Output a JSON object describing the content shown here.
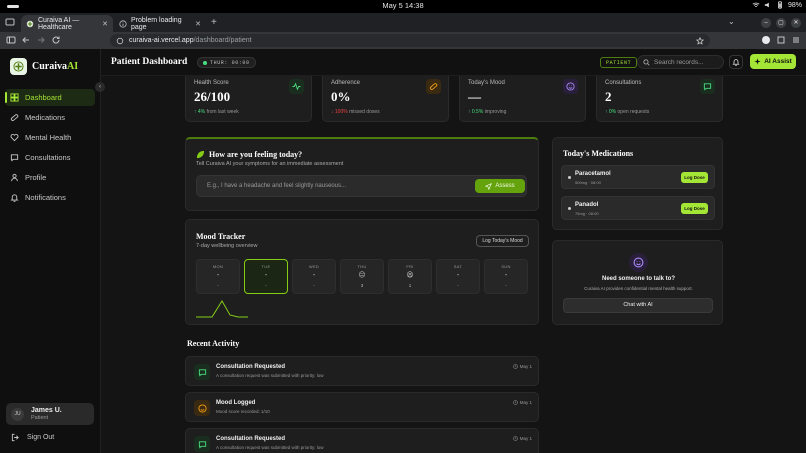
{
  "os": {
    "clock": "May 5  14:38",
    "battery": "98%"
  },
  "browser": {
    "tabs": [
      {
        "label": "Curaiva AI — Healthcare"
      },
      {
        "label": "Problem loading page"
      }
    ],
    "url_host": "curaiva-ai.vercel.app",
    "url_path": "/dashboard/patient"
  },
  "brand": {
    "name": "Curaiva",
    "suffix": "AI",
    "accent": "#a3e635"
  },
  "sidebar": {
    "items": [
      {
        "label": "Dashboard",
        "icon": "grid-icon"
      },
      {
        "label": "Medications",
        "icon": "pill-icon"
      },
      {
        "label": "Mental Health",
        "icon": "heart-icon"
      },
      {
        "label": "Consultations",
        "icon": "chat-icon"
      },
      {
        "label": "Profile",
        "icon": "user-icon"
      },
      {
        "label": "Notifications",
        "icon": "bell-icon"
      }
    ],
    "user": {
      "initials": "JU",
      "name": "James U.",
      "role": "Patient"
    },
    "sign_out": "Sign Out"
  },
  "header": {
    "title": "Patient Dashboard",
    "day_badge": "THUR: 00:00",
    "role_badge": "PATIENT",
    "search_placeholder": "Search records...",
    "ai_button": "AI Assist"
  },
  "stats": [
    {
      "label": "Health Score",
      "value": "26/100",
      "delta": "4%",
      "note": "from last week",
      "trend": "up",
      "icon": "pulse-icon",
      "color": "#4ade80"
    },
    {
      "label": "Adherence",
      "value": "0%",
      "delta": "100%",
      "note": "missed doses",
      "trend": "down",
      "icon": "pill-icon",
      "color": "#f59e0b"
    },
    {
      "label": "Today's Mood",
      "value": "—",
      "delta": "0.5%",
      "note": "improving",
      "trend": "up",
      "icon": "smile-icon",
      "color": "#a78bfa"
    },
    {
      "label": "Consultations",
      "value": "2",
      "delta": "0%",
      "note": "open requests",
      "trend": "up",
      "icon": "chat-icon",
      "color": "#4ade80"
    }
  ],
  "feeling": {
    "title": "How are you feeling today?",
    "subtitle": "Tell Curaiva AI your symptoms for an immediate assessment",
    "placeholder": "E.g., I have a headache and feel slightly nauseous...",
    "button": "Assess"
  },
  "mood": {
    "title": "Mood Tracker",
    "subtitle": "7-day wellbeing overview",
    "button": "Log Today's Mood",
    "days": [
      {
        "day": "MON",
        "emoji": "-",
        "score": "-"
      },
      {
        "day": "TUE",
        "emoji": "-",
        "score": "-"
      },
      {
        "day": "WED",
        "emoji": "-",
        "score": "-"
      },
      {
        "day": "THU",
        "emoji": "😐",
        "score": "3"
      },
      {
        "day": "FRI",
        "emoji": "😫",
        "score": "1"
      },
      {
        "day": "SAT",
        "emoji": "-",
        "score": "-"
      },
      {
        "day": "SUN",
        "emoji": "-",
        "score": "-"
      }
    ],
    "today_index": 1
  },
  "recent": {
    "title": "Recent Activity",
    "items": [
      {
        "title": "Consultation Requested",
        "desc": "A consultation request was submitted with priority: low",
        "time": "May 1",
        "icon": "chat-icon",
        "color": "#4ade80"
      },
      {
        "title": "Mood Logged",
        "desc": "Mood score recorded: 1/10",
        "time": "May 1",
        "icon": "smile-icon",
        "color": "#f59e0b"
      },
      {
        "title": "Consultation Requested",
        "desc": "A consultation request was submitted with priority: low",
        "time": "May 1",
        "icon": "chat-icon",
        "color": "#4ade80"
      }
    ]
  },
  "medications": {
    "title": "Today's Medications",
    "items": [
      {
        "name": "Paracetamol",
        "dose": "500mg · 08:00",
        "button": "Log Dose"
      },
      {
        "name": "Panadol",
        "dose": "75mg · 08:00",
        "button": "Log Dose"
      }
    ]
  },
  "talk": {
    "title": "Need someone to talk to?",
    "subtitle": "Curaiva AI provides confidential mental health support.",
    "button": "Chat with AI"
  }
}
